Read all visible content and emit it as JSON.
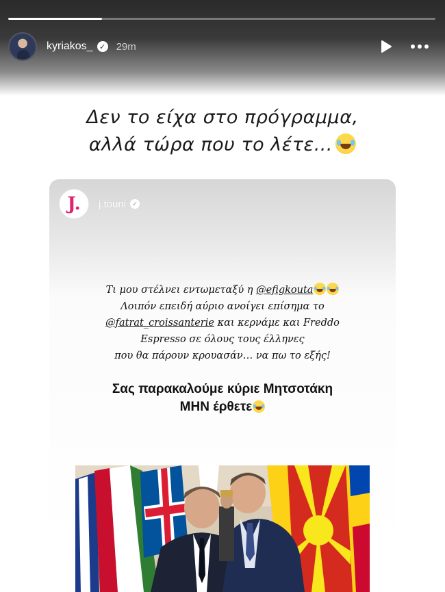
{
  "story": {
    "progress": 0.22,
    "username": "kyriakos_",
    "time": "29m",
    "icons": {
      "verified": "verified-badge-icon",
      "play": "play-icon",
      "more": "more-options-icon"
    }
  },
  "caption": {
    "line1": "Δεν το είχα στο πρόγραμμα,",
    "line2": "αλλά τώρα που το λέτε…"
  },
  "repost": {
    "username": "j.touni",
    "avatar_letter": "J.",
    "text": {
      "p1_before": "Τι μου στέλνει εντωμεταξύ η ",
      "p1_mention": "@efigkouta",
      "p2": "Λοιπόν επειδή αύριο ανοίγει επίσημα το",
      "p3_mention": "@fatrat_croissanterie",
      "p3_after": " και κερνάμε και Freddo",
      "p4": "Espresso σε όλους τους έλληνες",
      "p5": "που θα πάρουν κρουασάν… να πω το εξής!"
    },
    "headline": {
      "line1": "Σας παρακαλούμε κύριε Μητσοτάκη",
      "line2": "ΜΗΝ έρθετε"
    }
  },
  "colors": {
    "brand_pink": "#e2226d",
    "flag_red": "#d52b1e",
    "flag_yellow": "#fcd116"
  }
}
